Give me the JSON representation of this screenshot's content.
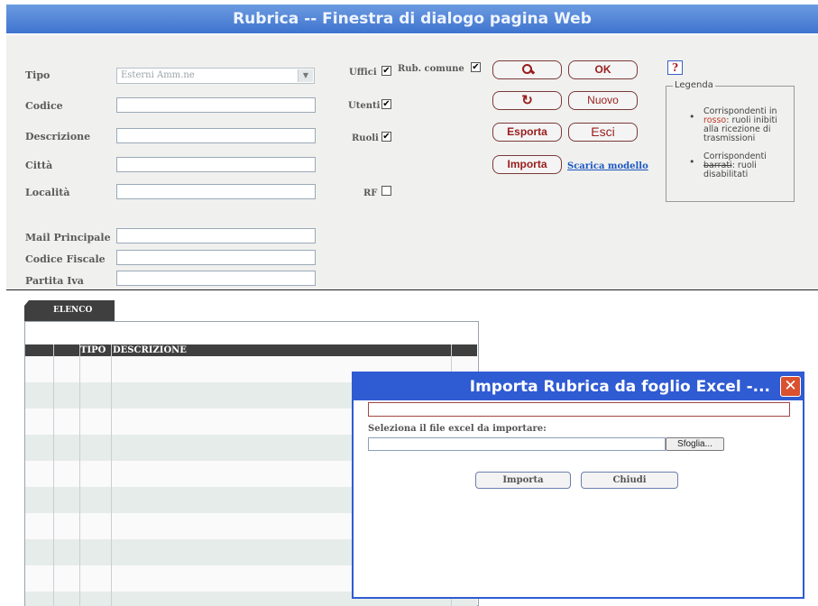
{
  "window": {
    "title": "Rubrica -- Finestra di dialogo pagina Web"
  },
  "form": {
    "tipo_label": "Tipo",
    "tipo_value": "Esterni Amm.ne",
    "codice_label": "Codice",
    "descrizione_label": "Descrizione",
    "citta_label": "Città",
    "localita_label": "Località",
    "mail_label": "Mail Principale",
    "cf_label": "Codice Fiscale",
    "piva_label": "Partita Iva"
  },
  "filters": {
    "uffici": {
      "label": "Uffici",
      "checked": "✔"
    },
    "utenti": {
      "label": "Utenti",
      "checked": "✔"
    },
    "ruoli": {
      "label": "Ruoli",
      "checked": "✔"
    },
    "rf": {
      "label": "RF",
      "checked": ""
    },
    "rub_comune": {
      "label": "Rub. comune",
      "checked": "✔"
    }
  },
  "buttons": {
    "ok": "OK",
    "nuovo": "Nuovo",
    "esporta": "Esporta",
    "esci": "Esci",
    "importa": "Importa",
    "scarica_modello": "Scarica modello",
    "help": "?"
  },
  "legend": {
    "title": "Legenda",
    "item1_pre": "Corrispondenti in",
    "item1_red": "rosso",
    "item1_post": ": ruoli inibiti alla ricezione di trasmissioni",
    "item2_pre": "Corrispondenti",
    "item2_strike": "barrati",
    "item2_post": ": ruoli disabilitati",
    "red_color": "#c0392b"
  },
  "list": {
    "tab": "ELENCO",
    "col_tipo": "TIPO",
    "col_descrizione": "DESCRIZIONE"
  },
  "dialog": {
    "title": "Importa Rubrica da foglio Excel -...",
    "select_label": "Seleziona il file excel da importare:",
    "browse": "Sfoglia...",
    "importa": "Importa",
    "chiudi": "Chiudi"
  },
  "colors": {
    "title_bar": "#4f84d6",
    "dialog_blue": "#2f5bd3",
    "button_text": "#9a1d1d"
  }
}
